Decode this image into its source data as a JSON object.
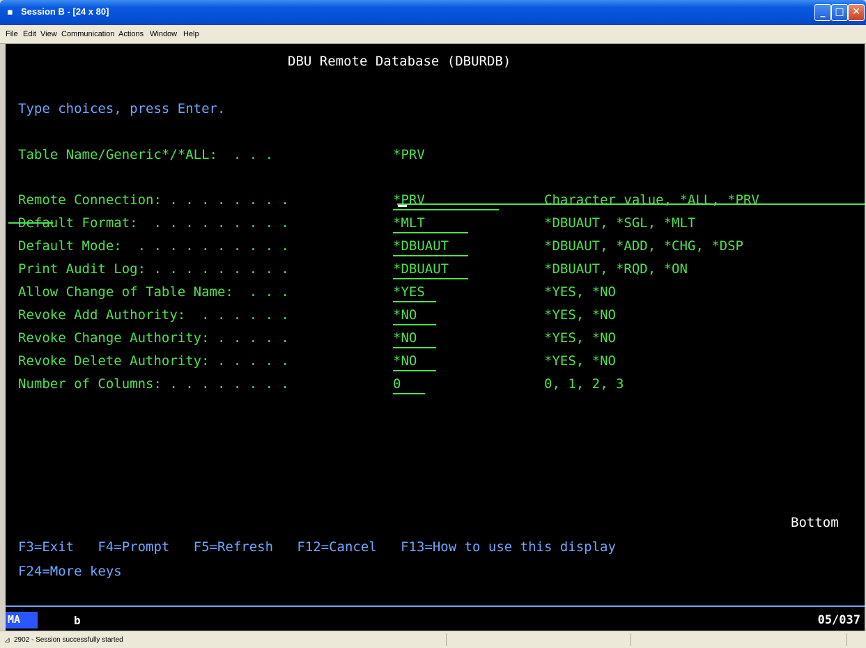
{
  "window": {
    "title": "Session B - [24 x 80]",
    "app_icon": "terminal-session-icon"
  },
  "menu": [
    "File",
    "Edit",
    "View",
    "Communication",
    "Actions",
    "Window",
    "Help"
  ],
  "screen": {
    "title": "DBU Remote Database (DBURDB)",
    "instruction": "Type choices, press Enter.",
    "table_name": {
      "label": "Table Name/Generic*/*ALL:  . . .",
      "value": "*PRV"
    },
    "fields": [
      {
        "label": "Remote Connection: . . . . . . . .",
        "value": "*PRV",
        "help": "Character value, *ALL, *PRV"
      },
      {
        "label": "Default Format:  . . . . . . . . .",
        "value": "*MLT",
        "help": "*DBUAUT, *SGL, *MLT"
      },
      {
        "label": "Default Mode:  . . . . . . . . . .",
        "value": "*DBUAUT",
        "help": "*DBUAUT, *ADD, *CHG, *DSP"
      },
      {
        "label": "Print Audit Log: . . . . . . . . .",
        "value": "*DBUAUT",
        "help": "*DBUAUT, *RQD, *ON"
      },
      {
        "label": "Allow Change of Table Name:  . . .",
        "value": "*YES",
        "help": "*YES, *NO"
      },
      {
        "label": "Revoke Add Authority:  . . . . . .",
        "value": "*NO",
        "help": "*YES, *NO"
      },
      {
        "label": "Revoke Change Authority: . . . . .",
        "value": "*NO",
        "help": "*YES, *NO"
      },
      {
        "label": "Revoke Delete Authority: . . . . .",
        "value": "*NO",
        "help": "*YES, *NO"
      },
      {
        "label": "Number of Columns: . . . . . . . .",
        "value": "0",
        "help": "0, 1, 2, 3"
      }
    ],
    "bottom_label": "Bottom",
    "fkeys_line1": "F3=Exit   F4=Prompt   F5=Refresh   F12=Cancel   F13=How to use this display",
    "fkeys_line2": "F24=More keys"
  },
  "oia": {
    "indicator": "MA",
    "mode": "b",
    "cursor_pos": "05/037"
  },
  "status": {
    "text": "2902 - Session successfully started"
  }
}
